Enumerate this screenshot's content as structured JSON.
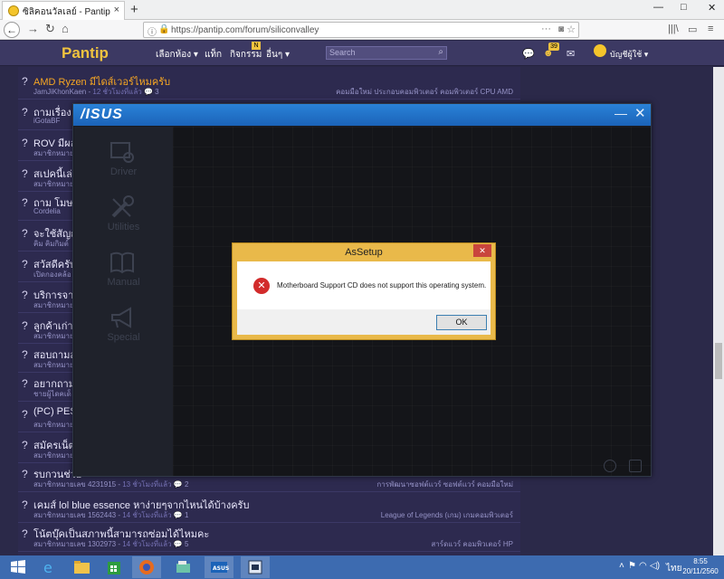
{
  "browser": {
    "tab_title": "ซิลิคอนวัลเลย์ - Pantip",
    "tab_close": "×",
    "new_tab": "+",
    "url": "https://pantip.com/forum/siliconvalley",
    "window_min": "—",
    "window_max": "□",
    "window_close": "✕"
  },
  "header": {
    "logo": "Pantip",
    "menu": [
      "เลือกห้อง ▾",
      "แท็ก",
      "กิจกรรม",
      "อื่นๆ ▾"
    ],
    "badge_n": "N",
    "search_placeholder": "Search",
    "notif_count": "39",
    "username": "บัญชีผู้ใช้ ▾"
  },
  "threads": [
    {
      "title": "AMD Ryzen มีไดส์เวอร์ไหมครับ",
      "author": "JamJiKhonKaen",
      "time": "12 ชั่วโมงที่แล้ว",
      "comments": "3",
      "tags": "คอมมือใหม่  ประกอบคอมพิวเตอร์  คอมพิวเตอร์  CPU  AMD",
      "highlight": true
    },
    {
      "title": "ถามเรื่อง S",
      "author": "iGotaBF",
      "time": "",
      "comments": "",
      "tags": "",
      "highlight": false
    },
    {
      "title": "ROV มีผล",
      "author": "สมาชิกหมายเ",
      "time": "",
      "comments": "",
      "tags": "",
      "highlight": false
    },
    {
      "title": "สเปคนี้เล่น",
      "author": "สมาชิกหมายเ",
      "time": "",
      "comments": "",
      "tags": "",
      "highlight": false
    },
    {
      "title": "ถาม โมษณ",
      "author": "Cordelia",
      "time": "",
      "comments": "",
      "tags": "",
      "highlight": false
    },
    {
      "title": "จะใช้สัญญู",
      "author": "คิม คิมกิมต์",
      "time": "",
      "comments": "",
      "tags": "",
      "highlight": false
    },
    {
      "title": "สวัสดีครับ",
      "author": "เปิดกองคล้อ",
      "time": "",
      "comments": "",
      "tags": "",
      "highlight": false
    },
    {
      "title": "บริการจาก",
      "author": "สมาชิกหมายเ",
      "time": "",
      "comments": "",
      "tags": "",
      "highlight": false
    },
    {
      "title": "ลูกค้าเก่าT",
      "author": "สมาชิกหมายเ",
      "time": "",
      "comments": "",
      "tags": "",
      "highlight": false
    },
    {
      "title": "สอบถามส",
      "author": "สมาชิกหมายเ",
      "time": "",
      "comments": "",
      "tags": "",
      "highlight": false
    },
    {
      "title": "อยากถามค",
      "author": "ชายผู้ไดคเด็",
      "time": "",
      "comments": "",
      "tags": "",
      "highlight": false
    },
    {
      "title": "(PC) PES",
      "author": "สมาชิกหมายเ",
      "time": "",
      "comments": "",
      "tags": "",
      "highlight": false
    },
    {
      "title": "สมัครเน็ตใ",
      "author": "สมาชิกหมายเ",
      "time": "",
      "comments": "",
      "tags": "",
      "highlight": false
    },
    {
      "title": "รบกวนช่วย",
      "author": "สมาชิกหมายเลข 4231915",
      "time": "13 ชั่วโมงที่แล้ว",
      "comments": "2",
      "tags": "การพัฒนาซอฟต์แวร์  ซอฟต์แวร์  คอมมือใหม่",
      "highlight": false
    },
    {
      "title": "เคมส์ lol blue essence หาง่ายๆจากไหนได้บ้างครับ",
      "author": "สมาชิกหมายเลข 1562443",
      "time": "14 ชั่วโมงที่แล้ว",
      "comments": "1",
      "tags": "League of Legends (เกม)  เกมคอมพิวเตอร์",
      "highlight": false
    },
    {
      "title": "โน้ตบุ๊คเป็นสภาพนี้สามารถซ่อมได้ไหมคะ",
      "author": "สมาชิกหมายเลข 1302973",
      "time": "14 ชั่วโมงที่แล้ว",
      "comments": "5",
      "tags": "สาร์ดแวร์  คอมพิวเตอร์ HP",
      "highlight": false
    }
  ],
  "asus": {
    "logo": "/ISUS",
    "min": "—",
    "close": "✕",
    "sidebar": [
      "Driver",
      "Utilities",
      "Manual",
      "Special"
    ]
  },
  "dialog": {
    "title": "AsSetup",
    "close": "✕",
    "error_glyph": "✕",
    "message": "Motherboard Support CD does not support this operating system.",
    "ok_label": "OK"
  },
  "taskbar": {
    "time": "8:55",
    "date": "20/11/2560",
    "lang": "ไทย"
  },
  "colors": {
    "pantip_bg": "#2b2949",
    "asus_blue": "#1b63b8",
    "dialog_frame": "#e9b94a",
    "taskbar": "#3d6bb0"
  }
}
